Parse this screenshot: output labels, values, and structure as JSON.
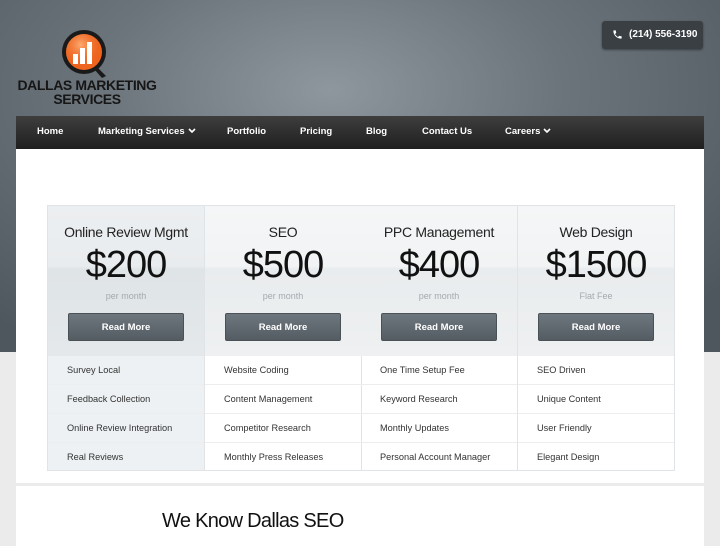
{
  "brand": {
    "name_line1": "DALLAS MARKETING",
    "name_line2": "SERVICES",
    "logo_colors": {
      "orange": "#f0651d",
      "dark": "#1a1a1a"
    }
  },
  "header": {
    "phone_icon": "phone-icon",
    "phone": "(214) 556-3190"
  },
  "nav": {
    "items": [
      {
        "label": "Home",
        "has_dropdown": false
      },
      {
        "label": "Marketing Services",
        "has_dropdown": true
      },
      {
        "label": "Portfolio",
        "has_dropdown": false
      },
      {
        "label": "Pricing",
        "has_dropdown": false
      },
      {
        "label": "Blog",
        "has_dropdown": false
      },
      {
        "label": "Contact Us",
        "has_dropdown": false
      },
      {
        "label": "Careers",
        "has_dropdown": true
      }
    ]
  },
  "pricing": {
    "plans": [
      {
        "title": "Online Review Mgmt",
        "price": "$200",
        "period": "per month",
        "button": "Read More",
        "featured": true,
        "features": [
          "Survey Local",
          "Feedback Collection",
          "Online Review Integration",
          "Real Reviews"
        ]
      },
      {
        "title": "SEO",
        "price": "$500",
        "period": "per month",
        "button": "Read More",
        "featured": false,
        "features": [
          "Website Coding",
          "Content Management",
          "Competitor Research",
          "Monthly Press Releases"
        ]
      },
      {
        "title": "PPC Management",
        "price": "$400",
        "period": "per month",
        "button": "Read More",
        "featured": false,
        "features": [
          "One Time Setup Fee",
          "Keyword Research",
          "Monthly Updates",
          "Personal Account Manager"
        ]
      },
      {
        "title": "Web Design",
        "price": "$1500",
        "period": "Flat Fee",
        "button": "Read More",
        "featured": false,
        "features": [
          "SEO Driven",
          "Unique Content",
          "User Friendly",
          "Elegant Design"
        ]
      }
    ]
  },
  "section": {
    "heading": "We Know Dallas SEO"
  },
  "colors": {
    "nav_bg": "#2c2c2c",
    "button_bg": "#5f676d",
    "hero_bg": "#6b747b"
  }
}
